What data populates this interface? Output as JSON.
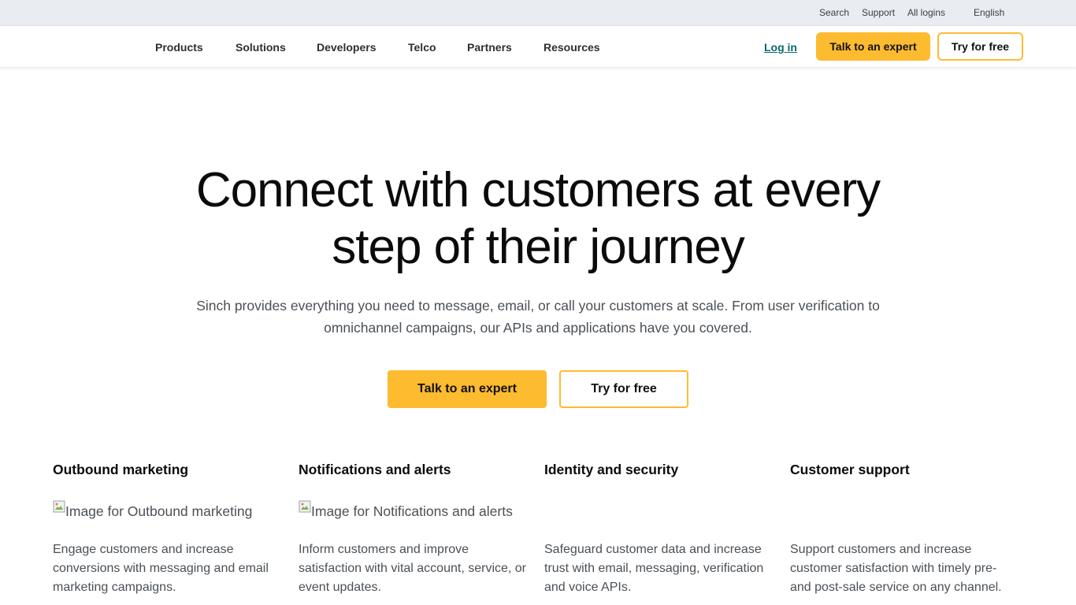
{
  "utility": {
    "search": "Search",
    "support": "Support",
    "all_logins": "All logins",
    "language": "English"
  },
  "nav": {
    "items": [
      "Products",
      "Solutions",
      "Developers",
      "Telco",
      "Partners",
      "Resources"
    ],
    "login": "Log in",
    "talk_to_expert": "Talk to an expert",
    "try_for_free": "Try for free"
  },
  "hero": {
    "title_line1": "Connect with customers at every",
    "title_line2": "step of their journey",
    "subtitle_line1": "Sinch provides everything you need to message, email, or call your customers at scale. From user verification to",
    "subtitle_line2": "omnichannel campaigns, our APIs and applications have you covered.",
    "cta_primary": "Talk to an expert",
    "cta_secondary": "Try for free"
  },
  "features": [
    {
      "title": "Outbound marketing",
      "image_alt": "Image for Outbound marketing",
      "description": "Engage customers and increase conversions with messaging and email marketing campaigns."
    },
    {
      "title": "Notifications and alerts",
      "image_alt": "Image for Notifications and alerts",
      "description": "Inform customers and improve satisfaction with vital account, service, or event updates."
    },
    {
      "title": "Identity and security",
      "image_alt": "",
      "description": "Safeguard customer data and increase trust with email, messaging, verification and voice APIs."
    },
    {
      "title": "Customer support",
      "image_alt": "",
      "description": "Support customers and increase customer satisfaction with timely pre- and post-sale service on any channel."
    }
  ],
  "colors": {
    "accent": "#fdbb30",
    "link": "#0b6b6b",
    "utility_bg": "#e9edf1"
  }
}
